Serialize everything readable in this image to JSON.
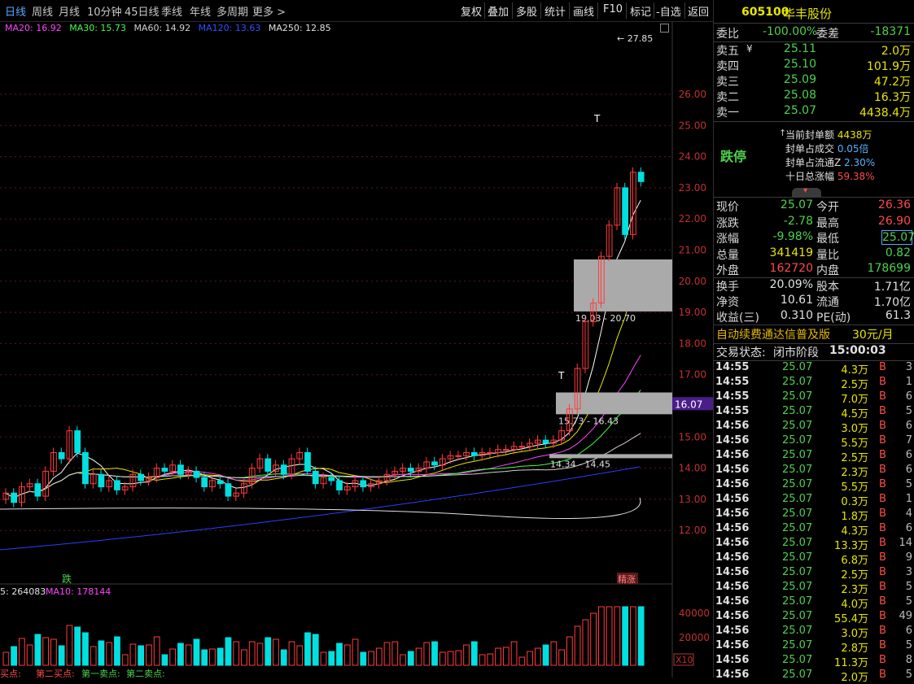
{
  "periods": [
    "日线",
    "周线",
    "月线",
    "10分钟",
    "45日线",
    "季线",
    "年线",
    "多周期",
    "更多 >"
  ],
  "toolbar": [
    "复权",
    "叠加",
    "多股",
    "统计",
    "画线",
    "F10",
    "标记",
    "-自选",
    "返回"
  ],
  "ma": [
    {
      "label": "MA20: 16.92",
      "color": "#ff44ff"
    },
    {
      "label": "MA30: 15.73",
      "color": "#44ff44"
    },
    {
      "label": "MA60: 14.92",
      "color": "#d0d0d0"
    },
    {
      "label": "MA120: 13.63",
      "color": "#3050ff"
    },
    {
      "label": "MA250: 12.85",
      "color": "#e0e0e0"
    }
  ],
  "price_axis": [
    "26.00",
    "25.00",
    "24.00",
    "23.00",
    "22.00",
    "21.00",
    "20.00",
    "19.00",
    "18.00",
    "17.00",
    "16.00",
    "15.00",
    "14.00",
    "13.00",
    "12.00"
  ],
  "current_price_tag": "16.07",
  "high_label": "27.85",
  "zones": [
    "19.03 - 20.70",
    "15.73 - 16.43",
    "14.34 - 14.45"
  ],
  "markers": {
    "die": "跌",
    "zhangting": "精涨",
    "t": "T"
  },
  "vol_legend": {
    "vol": "5: 264083",
    "ma10": "MA10: 178144"
  },
  "vol_axis": [
    "40000",
    "20000"
  ],
  "vol_unit": "X10",
  "bottom_labels": [
    "买点",
    "第二买点",
    "第一卖点",
    "第二卖点"
  ],
  "stock": {
    "code": "605100",
    "name": "华丰股份"
  },
  "weibi": {
    "l1": "委比",
    "v1": "-100.00%",
    "l2": "委差",
    "v2": "-18371"
  },
  "sells": [
    {
      "label": "卖五",
      "price": "25.11",
      "vol": "2.0万"
    },
    {
      "label": "卖四",
      "price": "25.10",
      "vol": "101.9万"
    },
    {
      "label": "卖三",
      "price": "25.09",
      "vol": "47.2万"
    },
    {
      "label": "卖二",
      "price": "25.08",
      "vol": "16.3万"
    },
    {
      "label": "卖一",
      "price": "25.07",
      "vol": "4438.4万"
    }
  ],
  "yen": "¥",
  "status_word": "跌停",
  "seal_info": [
    {
      "label": "当前封单额",
      "value": "4438万",
      "color": "#e6e600"
    },
    {
      "label": "封单占成交",
      "value": "0.05倍",
      "color": "#5ab0ff"
    },
    {
      "label": "封单占流通Z",
      "value": "2.30%",
      "color": "#5ab0ff"
    },
    {
      "label": "十日总涨幅",
      "value": "59.38%",
      "color": "#ff4a4a"
    }
  ],
  "quote": [
    {
      "l1": "现价",
      "v1": "25.07",
      "c1": "#4cd24c",
      "l2": "今开",
      "v2": "26.36",
      "c2": "#ff4a4a"
    },
    {
      "l1": "涨跌",
      "v1": "-2.78",
      "c1": "#4cd24c",
      "l2": "最高",
      "v2": "26.90",
      "c2": "#ff4a4a"
    },
    {
      "l1": "涨幅",
      "v1": "-9.98%",
      "c1": "#4cd24c",
      "l2": "最低",
      "v2": "25.07",
      "c2": "#4cd24c"
    },
    {
      "l1": "总量",
      "v1": "341419",
      "c1": "#e6e600",
      "l2": "量比",
      "v2": "0.82",
      "c2": "#4cd24c"
    },
    {
      "l1": "外盘",
      "v1": "162720",
      "c1": "#ff4a4a",
      "l2": "内盘",
      "v2": "178699",
      "c2": "#4cd24c"
    }
  ],
  "fund": [
    {
      "l1": "换手",
      "v1": "20.09%",
      "l2": "股本",
      "v2": "1.71亿"
    },
    {
      "l1": "净资",
      "v1": "10.61",
      "l2": "流通",
      "v2": "1.70亿"
    },
    {
      "l1": "收益(三)",
      "v1": "0.310",
      "l2": "PE(动)",
      "v2": "61.3"
    }
  ],
  "ad": {
    "text": "自动续费通达信普及版",
    "price": "30元/月"
  },
  "trade_state": {
    "label": "交易状态:",
    "value": "闭市阶段",
    "time": "15:00:03"
  },
  "ticks": [
    [
      "14:55",
      "25.07",
      "4.3万",
      "B",
      "3"
    ],
    [
      "14:55",
      "25.07",
      "2.5万",
      "B",
      "1"
    ],
    [
      "14:55",
      "25.07",
      "7.0万",
      "B",
      "6"
    ],
    [
      "14:55",
      "25.07",
      "4.5万",
      "B",
      "5"
    ],
    [
      "14:56",
      "25.07",
      "3.0万",
      "B",
      "6"
    ],
    [
      "14:56",
      "25.07",
      "5.5万",
      "B",
      "7"
    ],
    [
      "14:56",
      "25.07",
      "2.5万",
      "B",
      "6"
    ],
    [
      "14:56",
      "25.07",
      "2.3万",
      "B",
      "6"
    ],
    [
      "14:56",
      "25.07",
      "5.5万",
      "B",
      "5"
    ],
    [
      "14:56",
      "25.07",
      "0.3万",
      "B",
      "1"
    ],
    [
      "14:56",
      "25.07",
      "1.8万",
      "B",
      "4"
    ],
    [
      "14:56",
      "25.07",
      "4.3万",
      "B",
      "6"
    ],
    [
      "14:56",
      "25.07",
      "13.3万",
      "B",
      "14"
    ],
    [
      "14:56",
      "25.07",
      "6.8万",
      "B",
      "9"
    ],
    [
      "14:56",
      "25.07",
      "2.5万",
      "B",
      "3"
    ],
    [
      "14:56",
      "25.07",
      "2.3万",
      "B",
      "5"
    ],
    [
      "14:56",
      "25.07",
      "4.0万",
      "B",
      "5"
    ],
    [
      "14:56",
      "25.07",
      "55.4万",
      "B",
      "49"
    ],
    [
      "14:56",
      "25.07",
      "3.0万",
      "B",
      "6"
    ],
    [
      "14:56",
      "25.07",
      "2.8万",
      "B",
      "5"
    ],
    [
      "14:56",
      "25.07",
      "11.3万",
      "B",
      "8"
    ],
    [
      "14:56",
      "25.07",
      "2.0万",
      "B",
      "5"
    ]
  ],
  "colors": {
    "up": "#ff3c3c",
    "down": "#00e0e0",
    "accent": "#5aa8ff"
  }
}
